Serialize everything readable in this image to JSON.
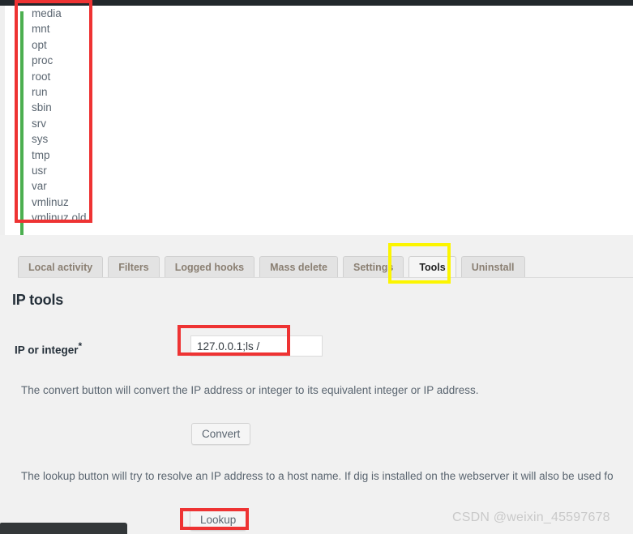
{
  "topbar": {
    "color": "#22282c"
  },
  "command_output": {
    "accent_color": "#4caf50",
    "annotation_color": "#ee3333",
    "entries": [
      "media",
      "mnt",
      "opt",
      "proc",
      "root",
      "run",
      "sbin",
      "srv",
      "sys",
      "tmp",
      "usr",
      "var",
      "vmlinuz",
      "vmlinuz.old"
    ]
  },
  "tabs": {
    "active_index": 5,
    "highlight_color": "#fcf500",
    "items": [
      {
        "label": "Local activity"
      },
      {
        "label": "Filters"
      },
      {
        "label": "Logged hooks"
      },
      {
        "label": "Mass delete"
      },
      {
        "label": "Settings"
      },
      {
        "label": "Tools"
      },
      {
        "label": "Uninstall"
      }
    ]
  },
  "main": {
    "section_title": "IP tools",
    "field": {
      "label": "IP or integer",
      "required_marker": "*",
      "value": "127.0.0.1;ls /",
      "placeholder": ""
    },
    "convert": {
      "help": "The convert button will convert the IP address or integer to its equivalent integer or IP address.",
      "button_label": "Convert"
    },
    "lookup": {
      "help": "The lookup button will try to resolve an IP address to a host name. If dig is installed on the webserver it will also be used fo",
      "button_label": "Lookup"
    }
  },
  "watermark": {
    "text": "CSDN @weixin_45597678"
  }
}
